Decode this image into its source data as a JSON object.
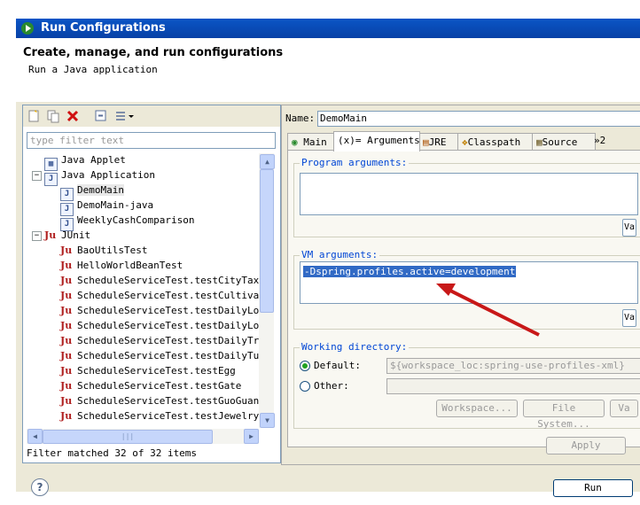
{
  "window": {
    "title": "Run Configurations"
  },
  "header": {
    "title": "Create, manage, and run configurations",
    "subtitle": "Run a Java application"
  },
  "left": {
    "filter_placeholder": "type filter text",
    "tree": [
      {
        "label": "Java Applet",
        "icon": "applet-icon"
      },
      {
        "label": "Java Application",
        "icon": "java-app-icon"
      },
      {
        "label": "DemoMain",
        "icon": "java-config-icon"
      },
      {
        "label": "DemoMain-java",
        "icon": "java-config-icon"
      },
      {
        "label": "WeeklyCashComparison",
        "icon": "java-config-icon"
      },
      {
        "label": "JUnit",
        "icon": "junit-icon"
      },
      {
        "label": "BaoUtilsTest",
        "icon": "junit-icon"
      },
      {
        "label": "HelloWorldBeanTest",
        "icon": "junit-icon"
      },
      {
        "label": "ScheduleServiceTest.testCityTax",
        "icon": "junit-icon"
      },
      {
        "label": "ScheduleServiceTest.testCultivate",
        "icon": "junit-icon"
      },
      {
        "label": "ScheduleServiceTest.testDailyLogi",
        "icon": "junit-icon"
      },
      {
        "label": "ScheduleServiceTest.testDailyLott",
        "icon": "junit-icon"
      },
      {
        "label": "ScheduleServiceTest.testDailyTrad",
        "icon": "junit-icon"
      },
      {
        "label": "ScheduleServiceTest.testDailyTuan",
        "icon": "junit-icon"
      },
      {
        "label": "ScheduleServiceTest.testEgg",
        "icon": "junit-icon"
      },
      {
        "label": "ScheduleServiceTest.testGate",
        "icon": "junit-icon"
      },
      {
        "label": "ScheduleServiceTest.testGuoGuan",
        "icon": "junit-icon"
      },
      {
        "label": "ScheduleServiceTest.testJewelry",
        "icon": "junit-icon"
      }
    ],
    "status": "Filter matched 32 of 32 items",
    "junit_glyph": "Ju",
    "j_glyph": "J"
  },
  "right": {
    "name_label": "Name:",
    "name_value": "DemoMain",
    "tabs": [
      "Main",
      "(x)= Arguments",
      "JRE",
      "Classpath",
      "Source",
      "»2"
    ],
    "program_args_label": "Program arguments:",
    "vm_args_label": "VM arguments:",
    "vm_args_value": "-Dspring.profiles.active=development",
    "variables_short": "Va",
    "working_dir_label": "Working directory:",
    "default_label": "Default:",
    "default_value": "${workspace_loc:spring-use-profiles-xml}",
    "other_label": "Other:",
    "workspace_btn": "Workspace...",
    "filesystem_btn": "File System...",
    "variables_btn_short": "Va",
    "apply_btn": "Apply"
  },
  "footer": {
    "run_btn": "Run",
    "help_glyph": "?"
  }
}
